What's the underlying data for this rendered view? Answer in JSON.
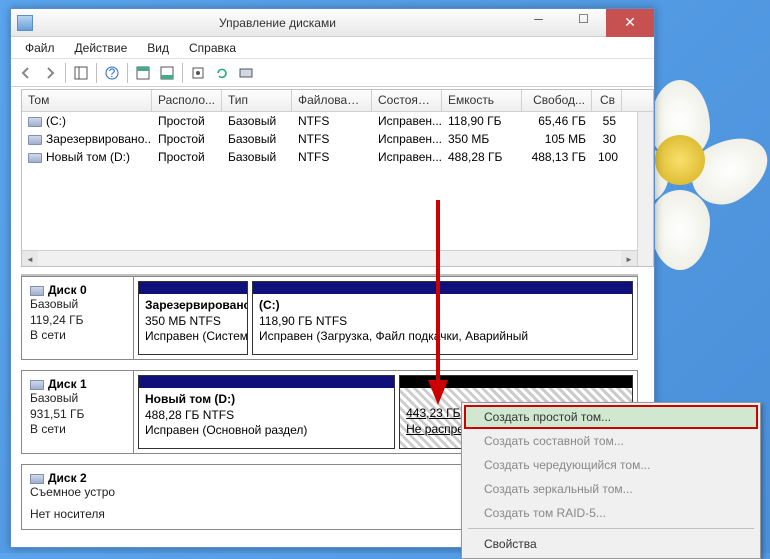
{
  "window": {
    "title": "Управление дисками"
  },
  "menu": {
    "file": "Файл",
    "action": "Действие",
    "view": "Вид",
    "help": "Справка"
  },
  "columns": {
    "tom": "Том",
    "raspol": "Располо...",
    "tip": "Тип",
    "fs": "Файловая с...",
    "sost": "Состояние",
    "emk": "Емкость",
    "svobod": "Свобод...",
    "svp": "Св"
  },
  "volumes": [
    {
      "name": "(C:)",
      "raspol": "Простой",
      "tip": "Базовый",
      "fs": "NTFS",
      "sost": "Исправен...",
      "emk": "118,90 ГБ",
      "svobod": "65,46 ГБ",
      "svp": "55"
    },
    {
      "name": "Зарезервировано...",
      "raspol": "Простой",
      "tip": "Базовый",
      "fs": "NTFS",
      "sost": "Исправен...",
      "emk": "350 МБ",
      "svobod": "105 МБ",
      "svp": "30"
    },
    {
      "name": "Новый том (D:)",
      "raspol": "Простой",
      "tip": "Базовый",
      "fs": "NTFS",
      "sost": "Исправен...",
      "emk": "488,28 ГБ",
      "svobod": "488,13 ГБ",
      "svp": "100"
    }
  ],
  "disks": {
    "d0": {
      "name": "Диск 0",
      "type": "Базовый",
      "size": "119,24 ГБ",
      "status": "В сети"
    },
    "d0p1": {
      "name": "Зарезервировано сис",
      "size": "350 МБ NTFS",
      "status": "Исправен (Система, А"
    },
    "d0p2": {
      "name": "(C:)",
      "size": "118,90 ГБ NTFS",
      "status": "Исправен (Загрузка, Файл подкачки, Аварийный"
    },
    "d1": {
      "name": "Диск 1",
      "type": "Базовый",
      "size": "931,51 ГБ",
      "status": "В сети"
    },
    "d1p1": {
      "name": "Новый том  (D:)",
      "size": "488,28 ГБ NTFS",
      "status": "Исправен (Основной раздел)"
    },
    "d1p2": {
      "size": "443,23 ГБ",
      "status": "Не распределена"
    },
    "d2": {
      "name": "Диск 2",
      "type": "Съемное устро",
      "status": "Нет носителя"
    }
  },
  "ctx": {
    "simple": "Создать простой том...",
    "span": "Создать составной том...",
    "stripe": "Создать чередующийся том...",
    "mirror": "Создать зеркальный том...",
    "raid5": "Создать том RAID-5...",
    "props": "Свойства"
  }
}
